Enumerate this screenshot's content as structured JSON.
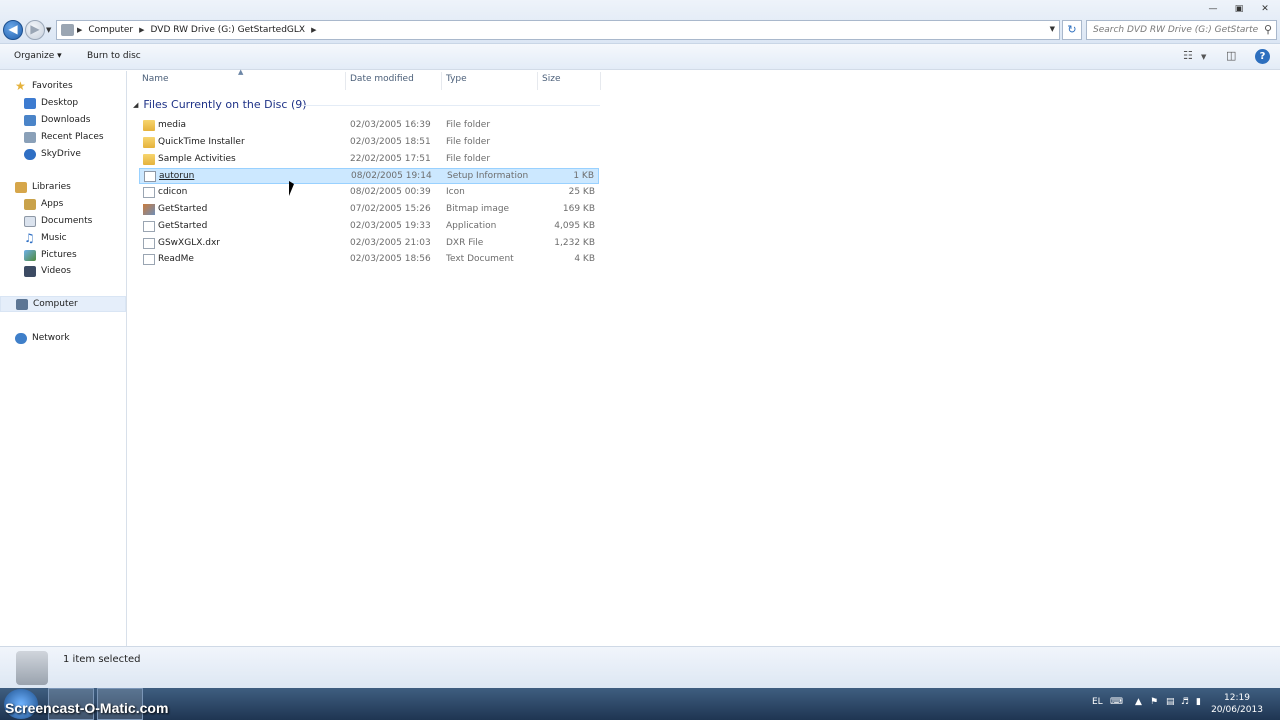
{
  "address_bar": {
    "crumbs": [
      "Computer",
      "DVD RW Drive (G:) GetStartedGLX"
    ],
    "search_placeholder": "Search DVD RW Drive (G:) GetStarted..."
  },
  "toolbar": {
    "organize_label": "Organize ▾",
    "burn_label": "Burn to disc"
  },
  "nav": {
    "favorites": "Favorites",
    "fav_items": [
      "Desktop",
      "Downloads",
      "Recent Places",
      "SkyDrive"
    ],
    "libraries": "Libraries",
    "lib_items": [
      "Apps",
      "Documents",
      "Music",
      "Pictures",
      "Videos"
    ],
    "computer": "Computer",
    "network": "Network"
  },
  "columns": {
    "name": "Name",
    "date": "Date modified",
    "type": "Type",
    "size": "Size"
  },
  "group_title": "Files Currently on the Disc (9)",
  "files": [
    {
      "name": "media",
      "date": "02/03/2005 16:39",
      "type": "File folder",
      "size": ""
    },
    {
      "name": "QuickTime Installer",
      "date": "02/03/2005 18:51",
      "type": "File folder",
      "size": ""
    },
    {
      "name": "Sample Activities",
      "date": "22/02/2005 17:51",
      "type": "File folder",
      "size": ""
    },
    {
      "name": "autorun",
      "date": "08/02/2005 19:14",
      "type": "Setup Information",
      "size": "1 KB"
    },
    {
      "name": "cdicon",
      "date": "08/02/2005 00:39",
      "type": "Icon",
      "size": "25 KB"
    },
    {
      "name": "GetStarted",
      "date": "07/02/2005 15:26",
      "type": "Bitmap image",
      "size": "169 KB"
    },
    {
      "name": "GetStarted",
      "date": "02/03/2005 19:33",
      "type": "Application",
      "size": "4,095 KB"
    },
    {
      "name": "GSwXGLX.dxr",
      "date": "02/03/2005 21:03",
      "type": "DXR File",
      "size": "1,232 KB"
    },
    {
      "name": "ReadMe",
      "date": "02/03/2005 18:56",
      "type": "Text Document",
      "size": "4 KB"
    }
  ],
  "status": {
    "text": "1 item selected"
  },
  "taskbar": {
    "watermark": "Screencast-O-Matic.com",
    "lang": "EL",
    "time": "12:19",
    "date": "20/06/2013"
  }
}
